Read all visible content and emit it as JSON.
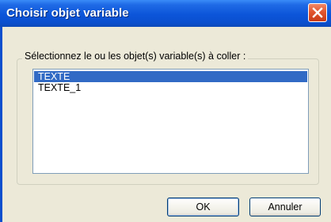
{
  "window": {
    "title": "Choisir objet variable"
  },
  "group": {
    "label": "Sélectionnez le ou les objet(s) variable(s) à coller :"
  },
  "list": {
    "items": [
      {
        "label": "TEXTE",
        "selected": true
      },
      {
        "label": "TEXTE_1",
        "selected": false
      }
    ]
  },
  "buttons": {
    "ok_label": "OK",
    "cancel_label": "Annuler"
  },
  "colors": {
    "titlebar": "#0a4fce",
    "selection": "#316ac5",
    "close_button": "#e2562f"
  }
}
